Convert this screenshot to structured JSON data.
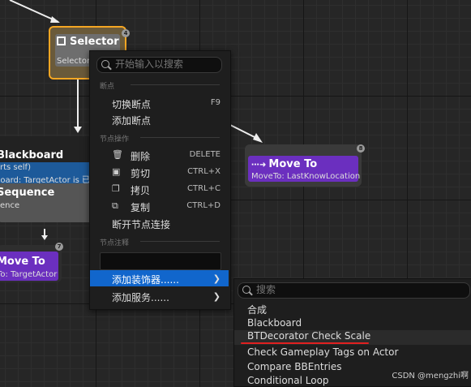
{
  "selector_node": {
    "title": "Selector",
    "subtitle": "Selector",
    "badge": "4"
  },
  "blackboard_node": {
    "title": "Blackboard Based",
    "line1": "rts self)",
    "line2": "board: TargetActor is 已"
  },
  "sequence_node": {
    "title": "Sequence",
    "subtitle": "ence"
  },
  "move_left_node": {
    "title": "Move To",
    "subtitle": "To: TargetActor",
    "badge": "7"
  },
  "move_right_node": {
    "title": "Move To",
    "subtitle": "MoveTo: LastKnowLocation",
    "badge": "8"
  },
  "context_menu": {
    "search_placeholder": "开始输入以搜索",
    "section_breakpoints": "断点",
    "toggle_breakpoint": "切换断点",
    "toggle_breakpoint_shortcut": "F9",
    "add_breakpoint": "添加断点",
    "section_node_actions": "节点操作",
    "delete": "删除",
    "delete_shortcut": "DELETE",
    "cut": "剪切",
    "cut_shortcut": "CTRL+X",
    "copy": "拷贝",
    "copy_shortcut": "CTRL+C",
    "duplicate": "复制",
    "duplicate_shortcut": "CTRL+D",
    "break_links": "断开节点连接",
    "section_node_comment": "节点注释",
    "add_decorator": "添加装饰器......",
    "add_service": "添加服务......"
  },
  "submenu": {
    "search_placeholder": "搜索",
    "items": [
      "合成",
      "Blackboard",
      "BTDecorator Check Scale",
      "Check Gameplay Tags on Actor",
      "Compare BBEntries",
      "Conditional Loop"
    ]
  },
  "watermark": "CSDN @mengzhi啊",
  "colors": {
    "highlight": "#1166cc",
    "selector_border": "#f5a623",
    "task_purple": "#6b2fbf",
    "annotation_red": "#e02020"
  }
}
